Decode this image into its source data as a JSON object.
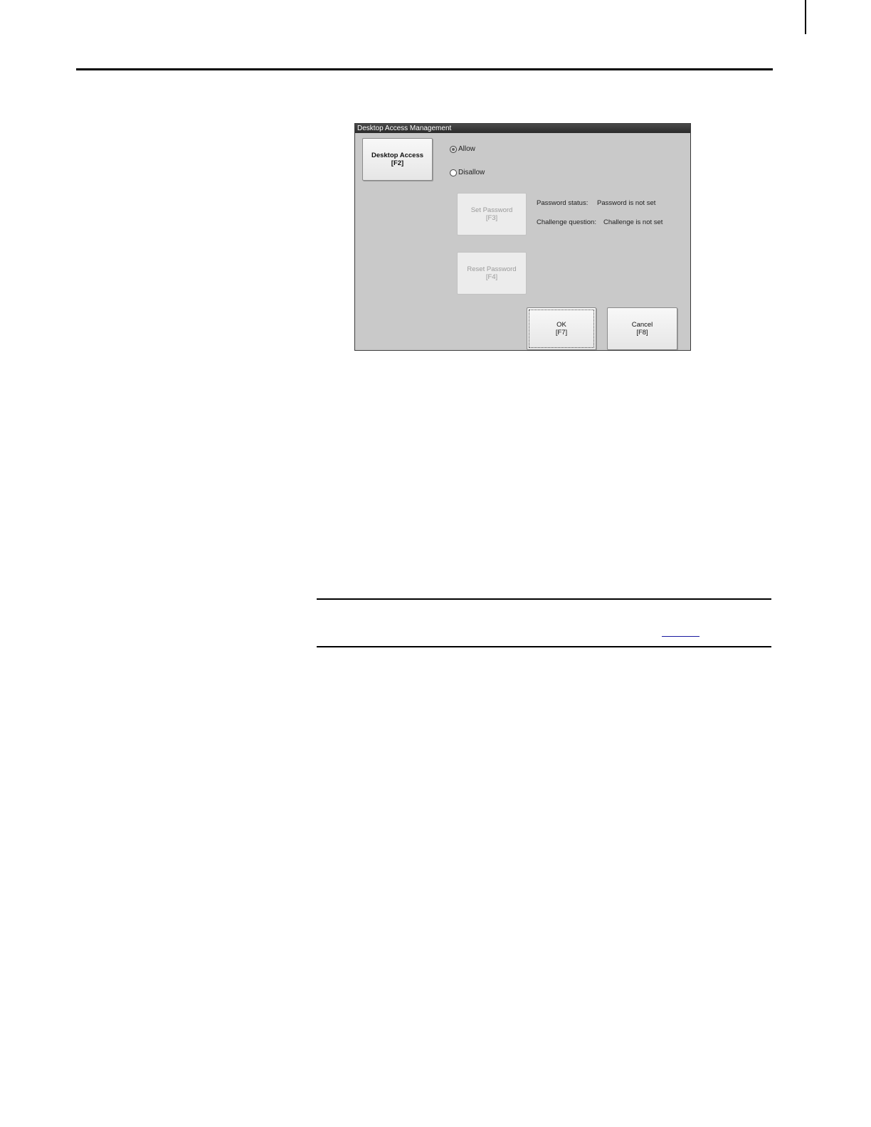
{
  "dialog": {
    "title": "Desktop Access Management",
    "desktop_access_button": {
      "label": "Desktop Access",
      "key": "[F2]"
    },
    "radios": {
      "allow": {
        "label": "Allow",
        "checked": true
      },
      "disallow": {
        "label": "Disallow",
        "checked": false
      }
    },
    "set_password_button": {
      "label": "Set Password",
      "key": "[F3]",
      "enabled": false
    },
    "reset_password_button": {
      "label": "Reset Password",
      "key": "[F4]",
      "enabled": false
    },
    "password_status": {
      "label": "Password status:",
      "value": "Password is not set"
    },
    "challenge_question": {
      "label": "Challenge question:",
      "value": "Challenge is not set"
    },
    "ok_button": {
      "label": "OK",
      "key": "[F7]"
    },
    "cancel_button": {
      "label": "Cancel",
      "key": "[F8]"
    }
  }
}
